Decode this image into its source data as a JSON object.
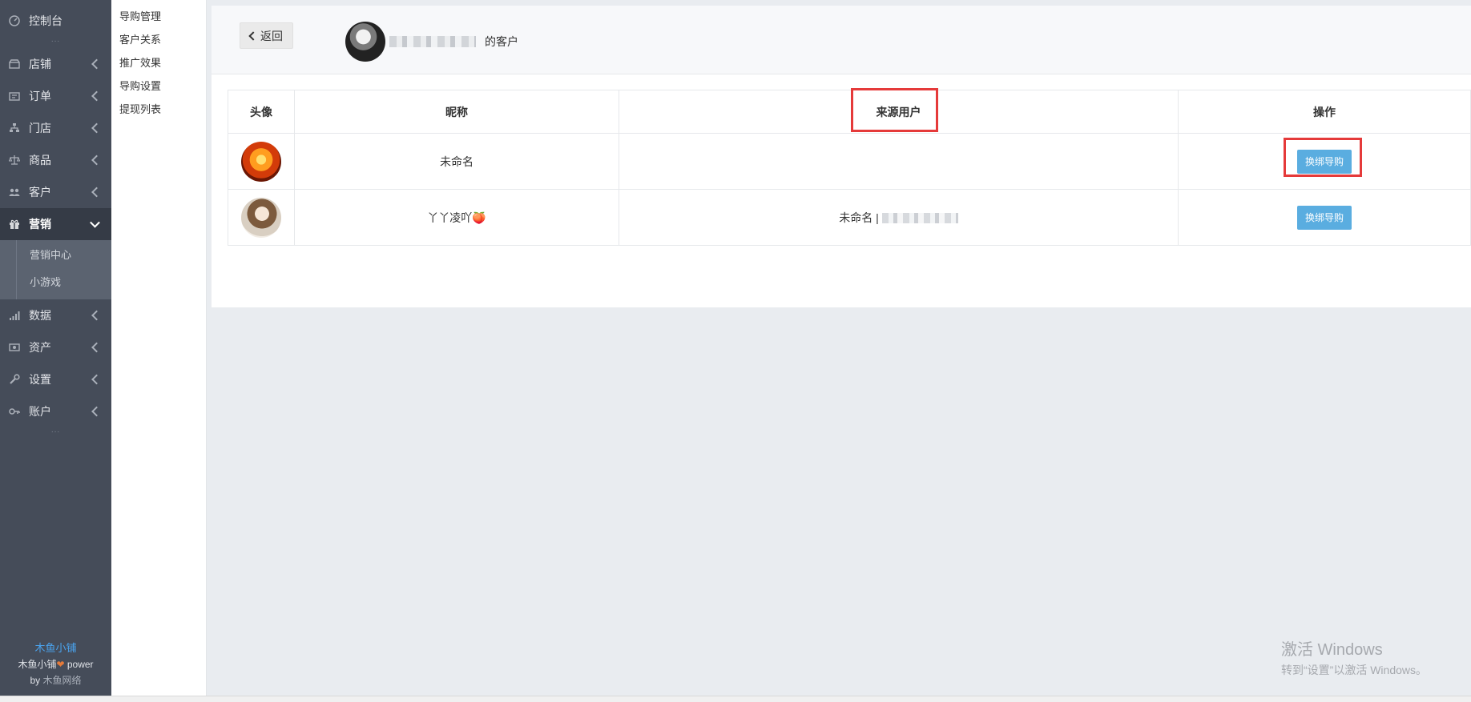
{
  "sidebar": {
    "items": [
      {
        "label": "控制台",
        "icon": "dashboard-icon",
        "chevron": false
      },
      {
        "label": "店铺",
        "icon": "store-icon",
        "chevron": true
      },
      {
        "label": "订单",
        "icon": "order-icon",
        "chevron": true
      },
      {
        "label": "门店",
        "icon": "sitemap-icon",
        "chevron": true
      },
      {
        "label": "商品",
        "icon": "scale-icon",
        "chevron": true
      },
      {
        "label": "客户",
        "icon": "users-icon",
        "chevron": true
      },
      {
        "label": "营销",
        "icon": "gift-icon",
        "chevron": true,
        "active": true
      },
      {
        "label": "数据",
        "icon": "signal-icon",
        "chevron": true
      },
      {
        "label": "资产",
        "icon": "money-icon",
        "chevron": true
      },
      {
        "label": "设置",
        "icon": "wrench-icon",
        "chevron": true
      },
      {
        "label": "账户",
        "icon": "key-icon",
        "chevron": true
      }
    ],
    "submenu": [
      "营销中心",
      "小游戏"
    ],
    "brand": {
      "name": "木鱼小铺",
      "line2_prefix": "木鱼小铺",
      "line2_suffix": "power",
      "line3_prefix": "by",
      "line3_link": "木鱼网络"
    }
  },
  "secondary_menu": [
    "导购管理",
    "客户关系",
    "推广效果",
    "导购设置",
    "提现列表"
  ],
  "header": {
    "back_label": "返回",
    "title_suffix": "的客户"
  },
  "table": {
    "columns": [
      "头像",
      "昵称",
      "来源用户",
      "操作"
    ],
    "rows": [
      {
        "nickname": "未命名",
        "source": "",
        "action": "换绑导购"
      },
      {
        "nickname": "丫丫凌吖🍑",
        "source_prefix": "未命名 |",
        "action": "换绑导购"
      }
    ]
  },
  "watermark": {
    "line1": "激活 Windows",
    "line2": "转到“设置”以激活 Windows。"
  },
  "colors": {
    "sidebar_bg": "#454c59",
    "action_btn": "#5aade0",
    "highlight": "#e53a3a"
  }
}
